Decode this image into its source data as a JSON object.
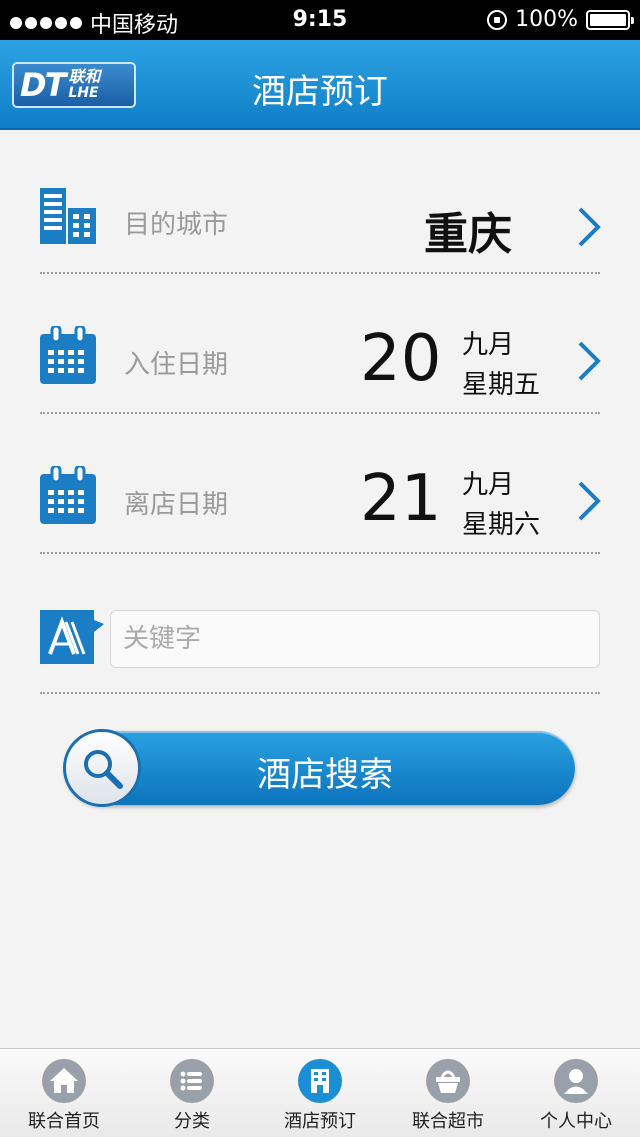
{
  "status_bar": {
    "carrier": "中国移动",
    "time": "9:15",
    "battery": "100%"
  },
  "header": {
    "logo_main": "DT",
    "logo_cn": "联和",
    "logo_en": "LHE",
    "title": "酒店预订"
  },
  "form": {
    "city": {
      "label": "目的城市",
      "value": "重庆"
    },
    "checkin": {
      "label": "入住日期",
      "day": "20",
      "month": "九月",
      "weekday": "星期五"
    },
    "checkout": {
      "label": "离店日期",
      "day": "21",
      "month": "九月",
      "weekday": "星期六"
    },
    "keyword": {
      "placeholder": "关键字"
    }
  },
  "search_button": {
    "label": "酒店搜索"
  },
  "tabbar": {
    "items": [
      {
        "label": "联合首页",
        "icon": "home-icon"
      },
      {
        "label": "分类",
        "icon": "list-icon"
      },
      {
        "label": "酒店预订",
        "icon": "hotel-icon",
        "active": true
      },
      {
        "label": "联合超市",
        "icon": "basket-icon"
      },
      {
        "label": "个人中心",
        "icon": "user-icon"
      }
    ]
  },
  "colors": {
    "accent": "#1a8fd4",
    "header": "#1a8fd4",
    "icon_inactive": "#9aa0aa"
  }
}
